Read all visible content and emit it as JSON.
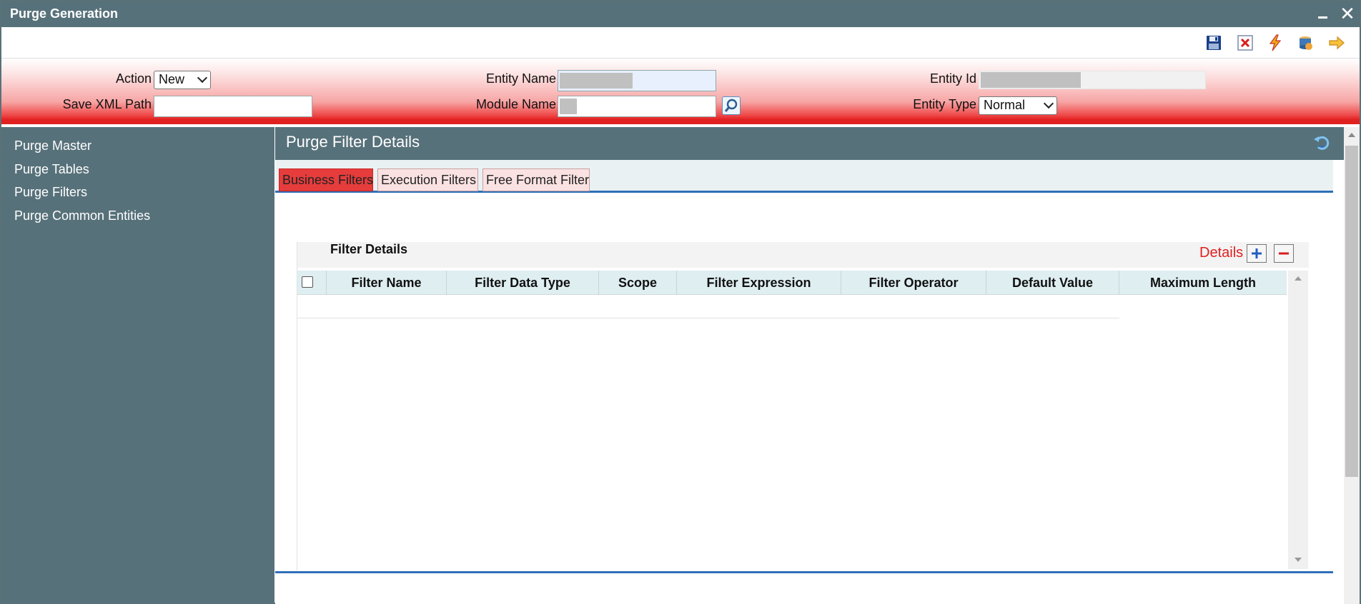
{
  "window": {
    "title": "Purge Generation"
  },
  "header": {
    "action_label": "Action",
    "action_value": "New",
    "save_xml_path_label": "Save XML Path",
    "save_xml_path_value": "",
    "entity_name_label": "Entity Name",
    "module_name_label": "Module Name",
    "entity_id_label": "Entity Id",
    "entity_type_label": "Entity Type",
    "entity_type_value": "Normal"
  },
  "sidebar": {
    "items": [
      {
        "label": "Purge Master"
      },
      {
        "label": "Purge Tables"
      },
      {
        "label": "Purge Filters"
      },
      {
        "label": "Purge Common Entities"
      }
    ]
  },
  "main": {
    "section_title": "Purge Filter Details",
    "tabs": [
      {
        "label": "Business Filters",
        "active": true
      },
      {
        "label": "Execution Filters",
        "active": false
      },
      {
        "label": "Free Format Filter",
        "active": false
      }
    ],
    "filter_details": {
      "title": "Filter Details",
      "details_link": "Details",
      "columns": [
        "Filter Name",
        "Filter Data Type",
        "Scope",
        "Filter Expression",
        "Filter Operator",
        "Default Value",
        "Maximum Length"
      ],
      "rows": []
    }
  },
  "colors": {
    "titlebar": "#57717a",
    "accent_red": "#e12020",
    "tab_active": "#e63c3c",
    "tab_inactive": "#fbe2e2",
    "link_blue": "#2f6fb8"
  },
  "icons": [
    "save-icon",
    "delete-icon",
    "execute-icon",
    "database-icon",
    "exit-icon",
    "search-icon",
    "refresh-icon",
    "plus-icon",
    "minus-icon"
  ]
}
